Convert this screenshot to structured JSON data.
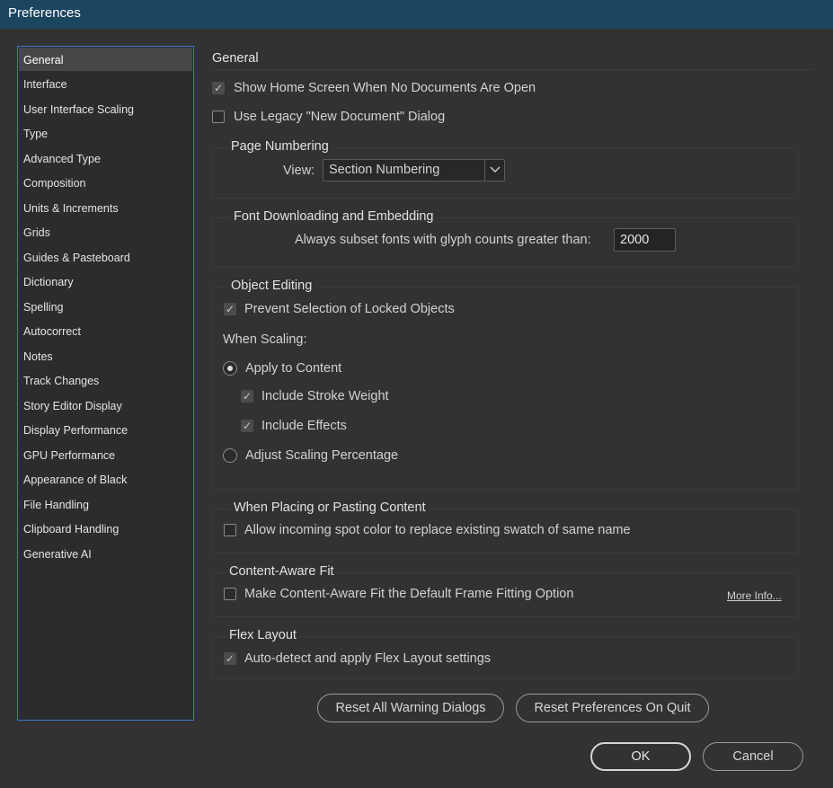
{
  "window": {
    "title": "Preferences"
  },
  "sidebar": {
    "selected_index": 0,
    "items": [
      "General",
      "Interface",
      "User Interface Scaling",
      "Type",
      "Advanced Type",
      "Composition",
      "Units & Increments",
      "Grids",
      "Guides & Pasteboard",
      "Dictionary",
      "Spelling",
      "Autocorrect",
      "Notes",
      "Track Changes",
      "Story Editor Display",
      "Display Performance",
      "GPU Performance",
      "Appearance of Black",
      "File Handling",
      "Clipboard Handling",
      "Generative AI"
    ]
  },
  "general": {
    "title": "General",
    "show_home_screen": {
      "label": "Show Home Screen When No Documents Are Open",
      "checked": true
    },
    "legacy_new_doc": {
      "label": "Use Legacy \"New Document\" Dialog",
      "checked": false
    }
  },
  "page_numbering": {
    "legend": "Page Numbering",
    "view_label": "View:",
    "view_value": "Section Numbering"
  },
  "font_downloading": {
    "legend": "Font Downloading and Embedding",
    "subset_label": "Always subset fonts with glyph counts greater than:",
    "subset_value": "2000"
  },
  "object_editing": {
    "legend": "Object Editing",
    "prevent_selection": {
      "label": "Prevent Selection of Locked Objects",
      "checked": true
    },
    "when_scaling": "When Scaling:",
    "apply_to_content": {
      "label": "Apply to Content",
      "selected": true
    },
    "include_stroke": {
      "label": "Include Stroke Weight",
      "checked": true
    },
    "include_effects": {
      "label": "Include Effects",
      "checked": true
    },
    "adjust_scaling": {
      "label": "Adjust Scaling Percentage",
      "selected": false
    }
  },
  "placing": {
    "legend": "When Placing or Pasting Content",
    "spot_color": {
      "label": "Allow incoming spot color to replace existing swatch of same name",
      "checked": false
    }
  },
  "content_aware": {
    "legend": "Content-Aware Fit",
    "default_option": {
      "label": "Make Content-Aware Fit the Default Frame Fitting Option",
      "checked": false
    },
    "more_info": "More Info..."
  },
  "flex_layout": {
    "legend": "Flex Layout",
    "auto_detect": {
      "label": "Auto-detect and apply Flex Layout settings",
      "checked": true
    }
  },
  "buttons": {
    "reset_warnings": "Reset All Warning Dialogs",
    "reset_prefs": "Reset Preferences On Quit",
    "ok": "OK",
    "cancel": "Cancel"
  },
  "icons": {
    "checkmark": "check-icon",
    "dropdown": "chevron-down-icon"
  },
  "colors": {
    "titlebar": "#1c4560",
    "selection_border": "#3a78c7",
    "background": "#323232"
  }
}
